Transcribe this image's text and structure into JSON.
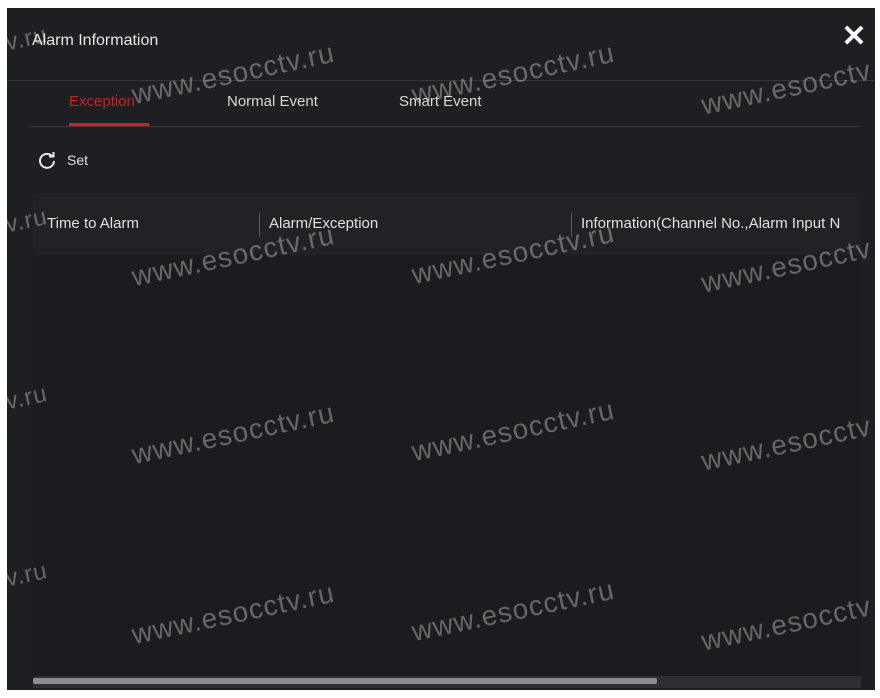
{
  "dialog": {
    "title": "Alarm Information",
    "close_label": "✕"
  },
  "tabs": [
    {
      "label": "Exception",
      "active": true
    },
    {
      "label": "Normal Event",
      "active": false
    },
    {
      "label": "Smart Event",
      "active": false
    }
  ],
  "toolbar": {
    "set_label": "Set",
    "set_icon": "refresh-icon"
  },
  "table": {
    "columns": [
      "Time to Alarm",
      "Alarm/Exception",
      "Information(Channel No.,Alarm Input N"
    ],
    "rows": []
  },
  "watermark": {
    "text_full": "www.esocctv.ru",
    "text_edge_a": "tv.ru",
    "text_edge_b": "www.esocctv"
  },
  "colors": {
    "accent": "#d21f1f",
    "background": "#1e1f22"
  }
}
